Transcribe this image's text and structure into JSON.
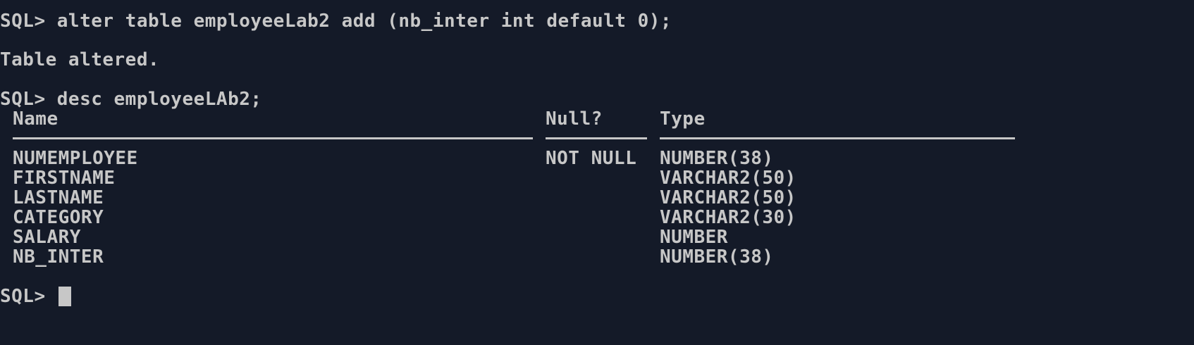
{
  "session": {
    "line1": "SQL> alter table employeeLab2 add (nb_inter int default 0);",
    "line2": "Table altered.",
    "line3": "SQL> desc employeeLAb2;",
    "prompt": "SQL> "
  },
  "desc": {
    "headers": {
      "name": "Name",
      "null": "Null?",
      "type": "Type"
    },
    "rows": [
      {
        "name": "NUMEMPLOYEE",
        "null": "NOT NULL",
        "type": "NUMBER(38)"
      },
      {
        "name": "FIRSTNAME",
        "null": "",
        "type": "VARCHAR2(50)"
      },
      {
        "name": "LASTNAME",
        "null": "",
        "type": "VARCHAR2(50)"
      },
      {
        "name": "CATEGORY",
        "null": "",
        "type": "VARCHAR2(30)"
      },
      {
        "name": "SALARY",
        "null": "",
        "type": "NUMBER"
      },
      {
        "name": "NB_INTER",
        "null": "",
        "type": "NUMBER(38)"
      }
    ]
  },
  "colors": {
    "background": "#141a28",
    "foreground": "#c7c7c7"
  }
}
